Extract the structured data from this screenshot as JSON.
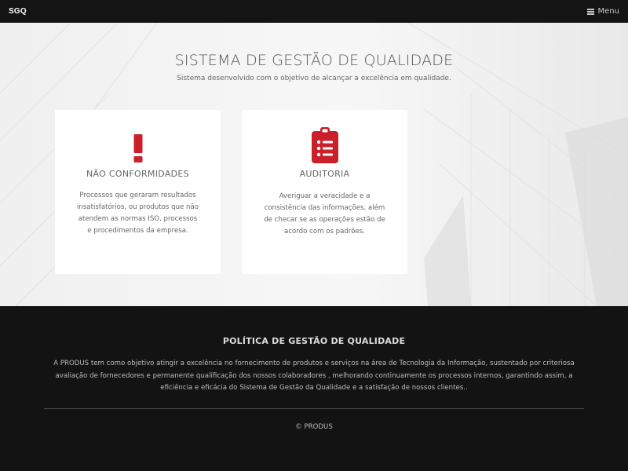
{
  "navbar": {
    "brand": "SGQ",
    "menu_label": "Menu",
    "menu_icon": "hamburger-icon"
  },
  "hero": {
    "title": "SISTEMA DE GESTÃO DE QUALIDADE",
    "subtitle": "Sistema desenvolvido com o objetivo de alcançar a excelência em qualidade."
  },
  "cards": [
    {
      "icon": "exclamation-icon",
      "title": "NÃO CONFORMIDADES",
      "text": "Processos que geraram resultados insatisfatórios, ou produtos que não atendem as normas ISO, processos e procedimentos da empresa."
    },
    {
      "icon": "clipboard-list-icon",
      "title": "AUDITORIA",
      "text": "Averiguar a veracidade e a consistência das informações, além de checar se as operações estão de acordo com os padrões."
    }
  ],
  "footer": {
    "policy_title": "POLÍTICA DE GESTÃO DE QUALIDADE",
    "policy_text": "A PRODUS tem como objetivo atingir a excelência no fornecimento de produtos e serviços na área de Tecnologia da Informação, sustentado por criteriosa avaliação de fornecedores e permanente qualificação dos nossos colaboradores , melhorando continuamente os processos internos, garantindo assim, a eficiência e eficácia do Sistema de Gestão da Qualidade e a satisfação de nossos clientes..",
    "copyright": "© PRODUS"
  },
  "colors": {
    "accent": "#c9202a",
    "navbar": "#141414",
    "footer": "#131313",
    "hero_bg": "#f3f3f3"
  }
}
